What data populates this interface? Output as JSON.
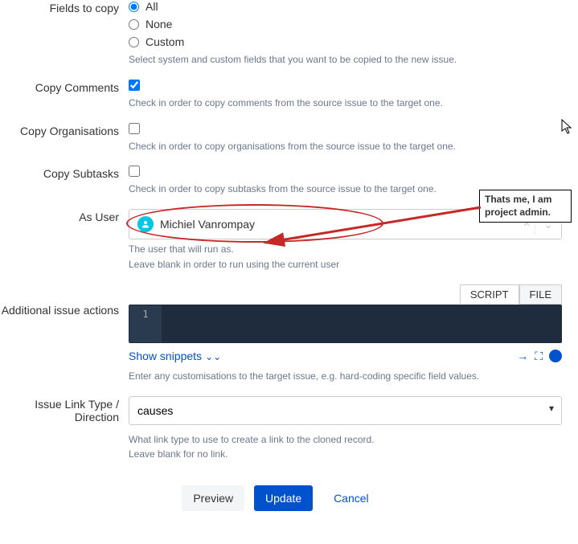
{
  "fieldsToCopy": {
    "label": "Fields to copy",
    "options": {
      "all": "All",
      "none": "None",
      "custom": "Custom"
    },
    "selected": "all",
    "help": "Select system and custom fields that you want to be copied to the new issue."
  },
  "copyComments": {
    "label": "Copy Comments",
    "checked": true,
    "help": "Check in order to copy comments from the source issue to the target one."
  },
  "copyOrganisations": {
    "label": "Copy Organisations",
    "checked": false,
    "help": "Check in order to copy organisations from the source issue to the target one."
  },
  "copySubtasks": {
    "label": "Copy Subtasks",
    "checked": false,
    "help": "Check in order to copy subtasks from the source issue to the target one."
  },
  "asUser": {
    "label": "As User",
    "value": "Michiel Vanrompay",
    "help1": "The user that will run as.",
    "help2": "Leave blank in order to run using the current user"
  },
  "callout": {
    "line1": "Thats me, I am",
    "line2": "project admin."
  },
  "additionalActions": {
    "label": "Additional issue actions",
    "tabs": {
      "script": "SCRIPT",
      "file": "FILE"
    },
    "activeTab": "script",
    "lineNum": "1",
    "showSnippets": "Show snippets",
    "help": "Enter any customisations to the target issue, e.g. hard-coding specific field values."
  },
  "issueLinkType": {
    "label": "Issue Link Type / Direction",
    "value": "causes",
    "help1": "What link type to use to create a link to the cloned record.",
    "help2": "Leave blank for no link."
  },
  "actions": {
    "preview": "Preview",
    "update": "Update",
    "cancel": "Cancel"
  }
}
